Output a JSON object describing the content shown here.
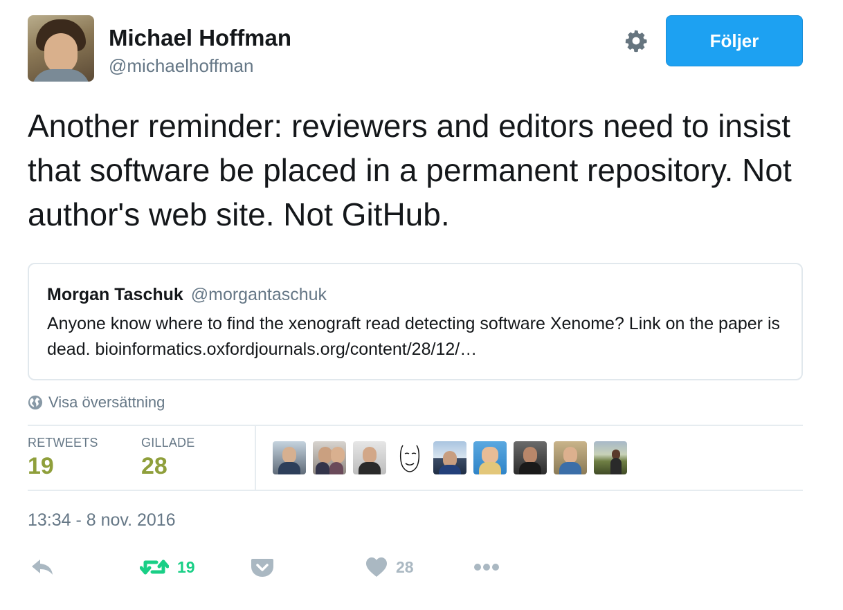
{
  "author": {
    "name": "Michael Hoffman",
    "handle": "@michaelhoffman"
  },
  "follow_button": {
    "label": "Följer"
  },
  "tweet": {
    "text": "Another reminder: reviewers and editors need to insist that software be placed in a permanent repository. Not author's web site. Not GitHub."
  },
  "quoted_tweet": {
    "name": "Morgan Taschuk",
    "handle": "@morgantaschuk",
    "text": "Anyone know where to find the xenograft read detecting software Xenome? Link on the paper is dead. bioinformatics.oxfordjournals.org/content/28/12/…"
  },
  "translate": {
    "label": "Visa översättning"
  },
  "stats": {
    "retweets_label": "RETWEETS",
    "retweets_value": "19",
    "likes_label": "GILLADE",
    "likes_value": "28"
  },
  "timestamp": "13:34 - 8 nov. 2016",
  "actions": {
    "retweet_count": "19",
    "like_count": "28"
  },
  "colors": {
    "accent": "#1da1f2",
    "stat_value": "#8f9f3b",
    "retweeted": "#19cf86",
    "secondary_text": "#657786",
    "icon_gray": "#aab8c2"
  },
  "icons": {
    "settings": "gear-icon",
    "translate": "globe-icon",
    "reply": "reply-icon",
    "retweet": "retweet-icon",
    "save": "pocket-icon",
    "like": "heart-icon",
    "more": "more-icon"
  }
}
